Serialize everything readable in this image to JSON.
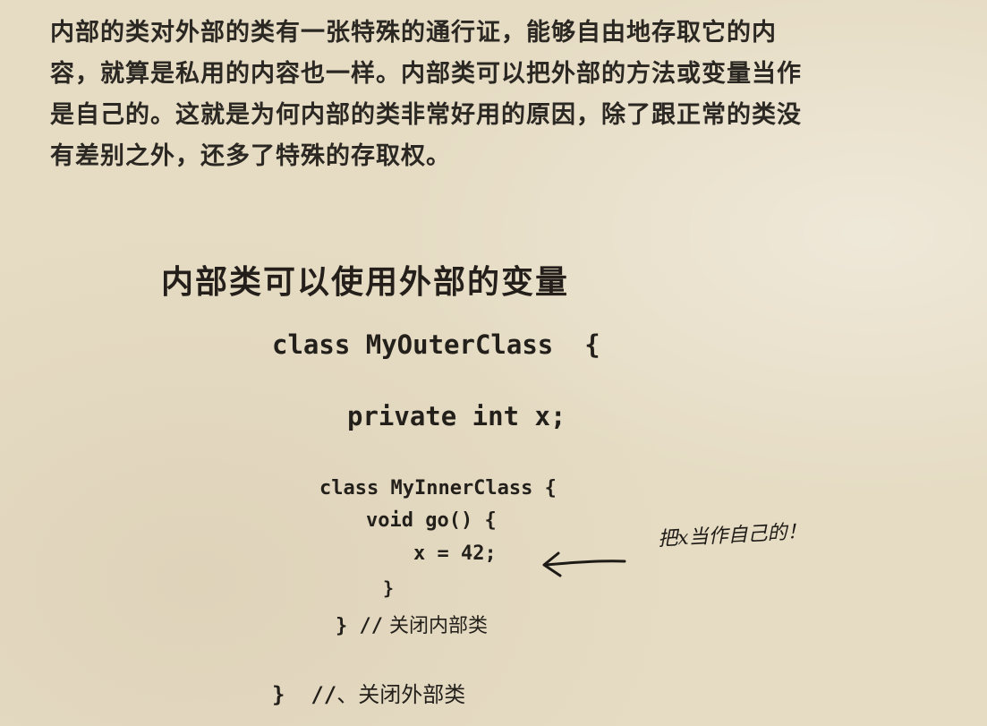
{
  "paragraph": {
    "line1": "内部的类对外部的类有一张特殊的通行证，能够自由地存取它的内",
    "line2": "容，就算是私用的内容也一样。内部类可以把外部的方法或变量当作",
    "line3": "是自己的。这就是为何内部的类非常好用的原因，除了跟正常的类没",
    "line4": "有差别之外，还多了特殊的存取权。"
  },
  "heading": "内部类可以使用外部的变量",
  "code": {
    "outer_decl": "class MyOuterClass  {",
    "field_decl": "private int x;",
    "inner_decl": "class MyInnerClass {",
    "method_decl": "void go() {",
    "assignment": "x = 42;",
    "close_method": "}",
    "close_inner_brace": "} //",
    "close_inner_comment": " 关闭内部类",
    "close_outer_brace": "}  //",
    "close_outer_comment": "、关闭外部类"
  },
  "annotation": {
    "handwritten_note": "把x当作自己的！"
  }
}
